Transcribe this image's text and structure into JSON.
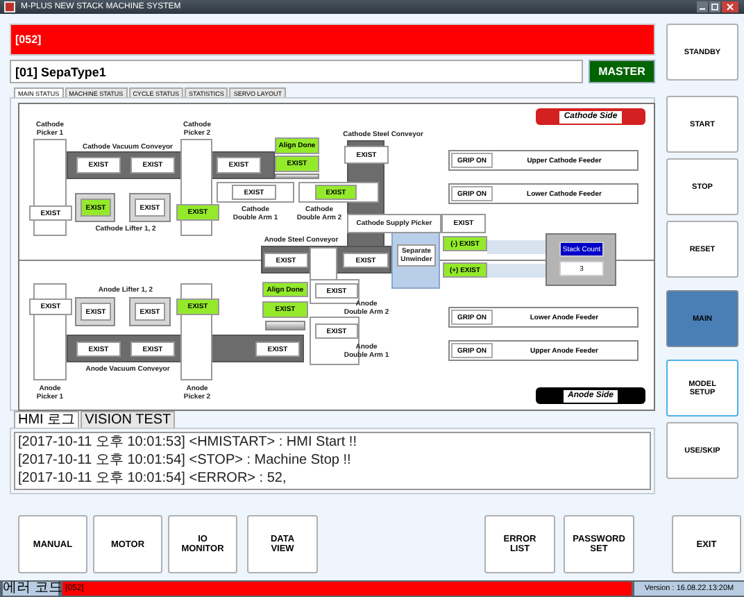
{
  "window": {
    "title": "M-PLUS NEW STACK MACHINE SYSTEM"
  },
  "alarm_bar": {
    "text": "[052]"
  },
  "model": {
    "name": "[01] SepaType1",
    "mode": "MASTER"
  },
  "tabs": [
    {
      "label": "MAIN STATUS",
      "selected": true
    },
    {
      "label": "MACHINE STATUS",
      "selected": false
    },
    {
      "label": "CYCLE STATUS",
      "selected": false
    },
    {
      "label": "STATISTICS",
      "selected": false
    },
    {
      "label": "SERVO LAYOUT",
      "selected": false
    }
  ],
  "diagram": {
    "side_badges": [
      {
        "label": "Cathode Side",
        "color": "#d42020"
      },
      {
        "label": "Anode Side",
        "color": "#000000"
      }
    ],
    "labels": [
      "Cathode\nPicker 1",
      "Cathode Vacuum Conveyor",
      "Cathode\nPicker 2",
      "Cathode Lifter 1, 2",
      "Cathode\nDouble Arm 1",
      "Cathode\nDouble Arm 2",
      "Cathode Steel Conveyor",
      "Cathode Supply Picker",
      "Anode Steel Conveyor",
      "Anode Lifter 1, 2",
      "Anode Vacuum Conveyor",
      "Anode\nPicker 1",
      "Anode\nPicker 2",
      "Anode\nDouble Arm 2",
      "Anode\nDouble Arm 1",
      "Separate\nUnwinder"
    ],
    "indicators": [
      {
        "label": "EXIST",
        "on": false
      },
      {
        "label": "EXIST",
        "on": false
      },
      {
        "label": "EXIST",
        "on": false
      },
      {
        "label": "EXIST",
        "on": false
      },
      {
        "label": "EXIST",
        "on": true
      },
      {
        "label": "EXIST",
        "on": false
      },
      {
        "label": "EXIST",
        "on": true
      },
      {
        "label": "Align Done",
        "on": true
      },
      {
        "label": "EXIST",
        "on": true
      },
      {
        "label": "EXIST",
        "on": false
      },
      {
        "label": "EXIST",
        "on": true
      },
      {
        "label": "EXIST",
        "on": false
      },
      {
        "label": "EXIST",
        "on": false
      },
      {
        "label": "EXIST",
        "on": false
      },
      {
        "label": "EXIST",
        "on": false
      },
      {
        "label": "(-) EXIST",
        "on": true
      },
      {
        "label": "(+) EXIST",
        "on": true
      },
      {
        "label": "EXIST",
        "on": false
      },
      {
        "label": "EXIST",
        "on": false
      },
      {
        "label": "EXIST",
        "on": false
      },
      {
        "label": "EXIST",
        "on": true
      },
      {
        "label": "Align Done",
        "on": true
      },
      {
        "label": "EXIST",
        "on": true
      },
      {
        "label": "EXIST",
        "on": false
      },
      {
        "label": "EXIST",
        "on": false
      },
      {
        "label": "EXIST",
        "on": false
      },
      {
        "label": "EXIST",
        "on": false
      },
      {
        "label": "EXIST",
        "on": false
      }
    ],
    "feeders": [
      {
        "button": "GRIP ON",
        "name": "Upper Cathode Feeder"
      },
      {
        "button": "GRIP ON",
        "name": "Lower Cathode Feeder"
      },
      {
        "button": "GRIP ON",
        "name": "Lower Anode Feeder"
      },
      {
        "button": "GRIP ON",
        "name": "Upper Anode Feeder"
      }
    ],
    "stack_count": {
      "label": "Stack Count",
      "value": "3"
    }
  },
  "log_tabs": [
    {
      "label": "HMI 로그",
      "selected": true
    },
    {
      "label": "VISION TEST",
      "selected": false
    }
  ],
  "log": [
    "[2017-10-11 오후 10:01:53] <HMISTART> : HMI Start !!",
    "[2017-10-11 오후 10:01:54] <STOP> : Machine Stop !!",
    "[2017-10-11 오후 10:01:54] <ERROR> : 52,"
  ],
  "side_buttons": [
    {
      "label": "STANDBY",
      "selected": false,
      "focused": false
    },
    {
      "label": "START",
      "selected": false,
      "focused": false
    },
    {
      "label": "STOP",
      "selected": false,
      "focused": false
    },
    {
      "label": "RESET",
      "selected": false,
      "focused": false
    },
    {
      "label": "MAIN",
      "selected": true,
      "focused": false
    },
    {
      "label": "MODEL\nSETUP",
      "selected": false,
      "focused": true
    },
    {
      "label": "USE/SKIP",
      "selected": false,
      "focused": false
    }
  ],
  "bottom_buttons": [
    "MANUAL",
    "MOTOR",
    "IO\nMONITOR",
    "DATA\nVIEW",
    "ERROR\nLIST",
    "PASSWORD\nSET",
    "EXIT"
  ],
  "status_bar": {
    "label": "에러 코드",
    "error": "[052]",
    "version": "Version : 16.08.22.13:20M"
  }
}
